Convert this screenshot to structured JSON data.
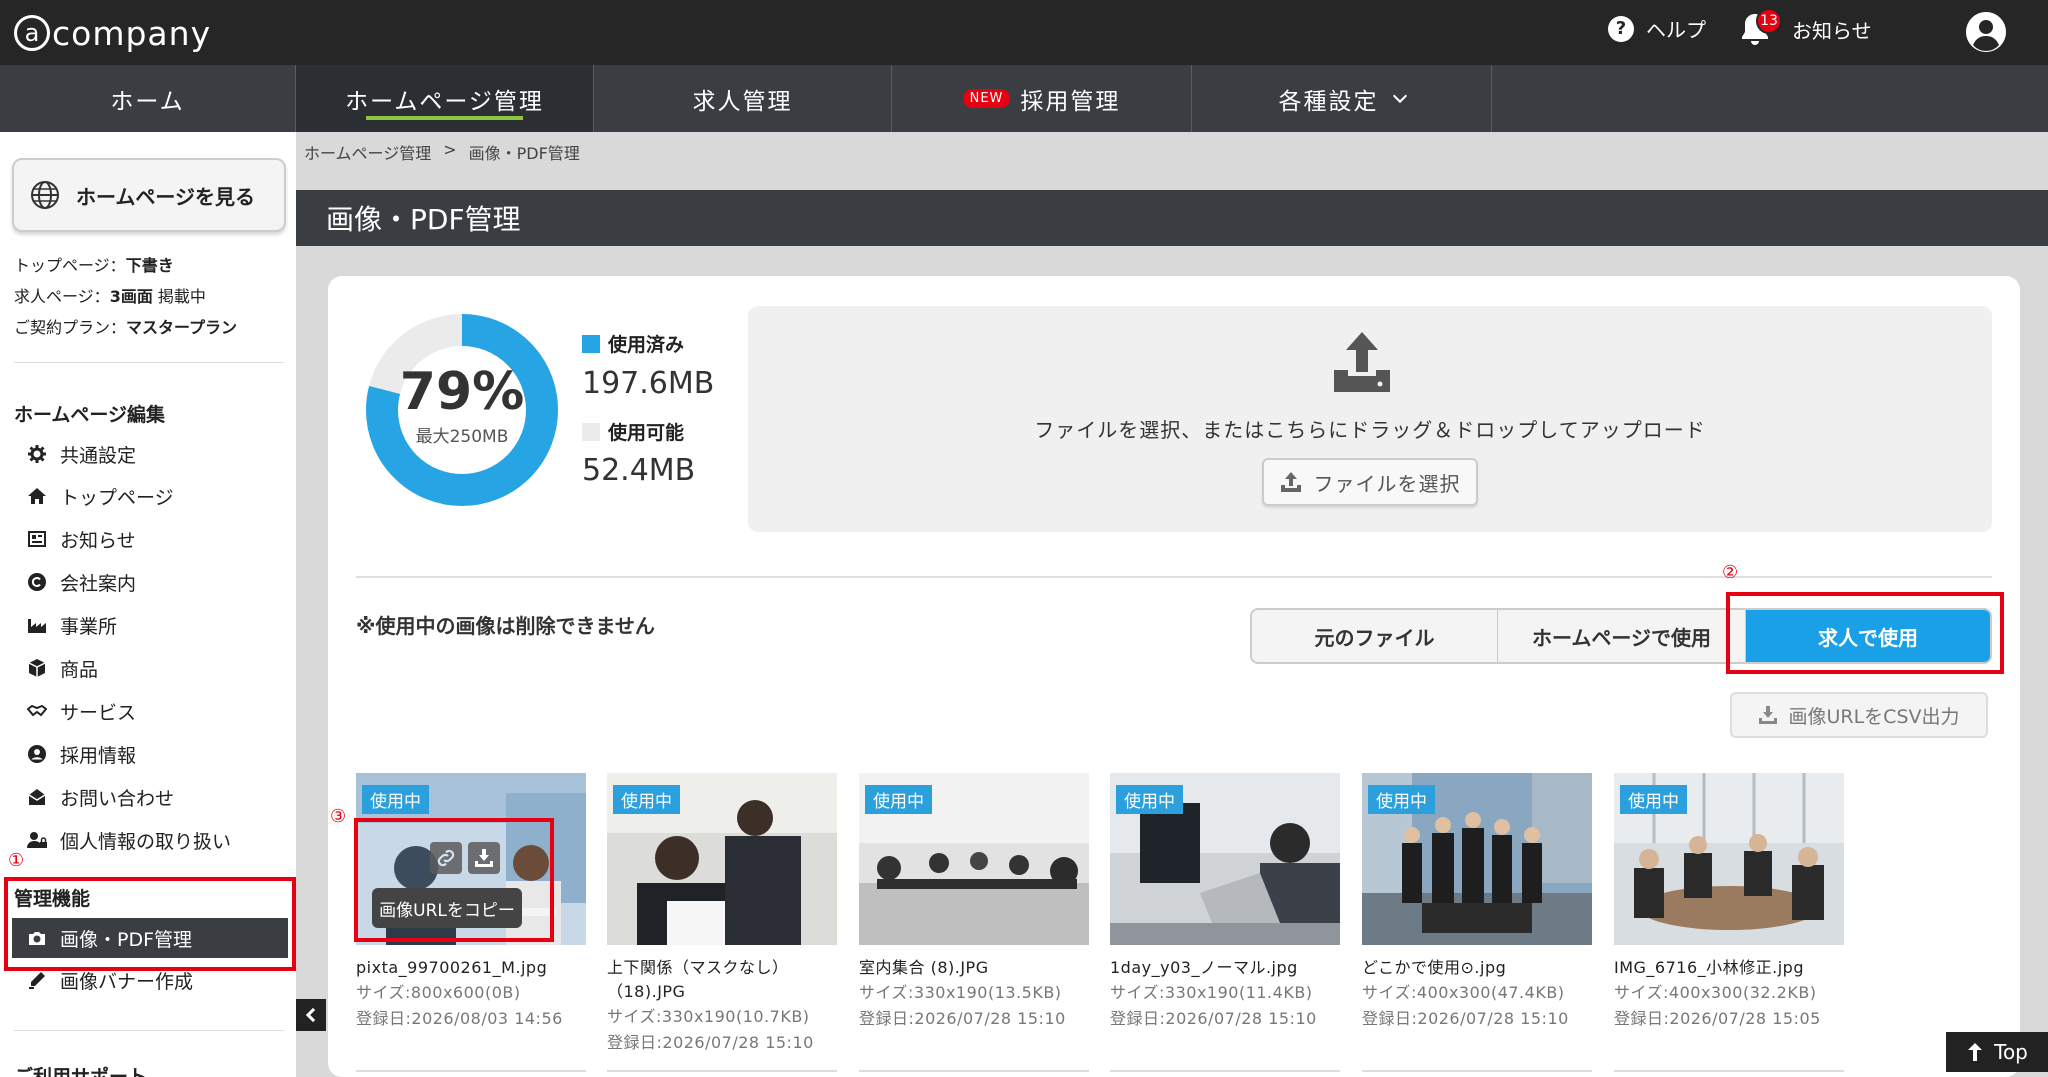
{
  "header": {
    "logo_text": "company",
    "help_label": "ヘルプ",
    "notice_label": "お知らせ",
    "notice_count": "13"
  },
  "nav": {
    "tabs": [
      {
        "label": "ホーム"
      },
      {
        "label": "ホームページ管理"
      },
      {
        "label": "求人管理"
      },
      {
        "label": "採用管理",
        "badge": "NEW"
      },
      {
        "label": "各種設定"
      }
    ]
  },
  "sidebar": {
    "view_site_label": "ホームページを見る",
    "info": [
      {
        "label": "トップページ：",
        "value": "下書き",
        "suffix": ""
      },
      {
        "label": "求人ページ：",
        "value": "3画面",
        "suffix": " 掲載中"
      },
      {
        "label": "ご契約プラン：",
        "value": "マスタープラン",
        "suffix": ""
      }
    ],
    "edit_heading": "ホームページ編集",
    "edit_items": [
      {
        "label": "共通設定",
        "icon": "gear-icon"
      },
      {
        "label": "トップページ",
        "icon": "home-icon"
      },
      {
        "label": "お知らせ",
        "icon": "newspaper-icon"
      },
      {
        "label": "会社案内",
        "icon": "copyright-icon"
      },
      {
        "label": "事業所",
        "icon": "industry-icon"
      },
      {
        "label": "商品",
        "icon": "cube-icon"
      },
      {
        "label": "サービス",
        "icon": "handshake-icon"
      },
      {
        "label": "採用情報",
        "icon": "user-circle-icon"
      },
      {
        "label": "お問い合わせ",
        "icon": "envelope-icon"
      },
      {
        "label": "個人情報の取り扱い",
        "icon": "user-lock-icon"
      }
    ],
    "admin_heading": "管理機能",
    "admin_items": [
      {
        "label": "画像・PDF管理",
        "icon": "camera-icon"
      },
      {
        "label": "画像バナー作成",
        "icon": "pen-icon"
      }
    ],
    "support_heading": "ご利用サポート"
  },
  "annotations": {
    "one": "①",
    "two": "②",
    "three": "③"
  },
  "breadcrumb": {
    "parent": "ホームページ管理",
    "separator": ">",
    "current": "画像・PDF管理"
  },
  "page_title": "画像・PDF管理",
  "storage": {
    "percent_label": "79%",
    "percent_value": 79,
    "max_label": "最大250MB",
    "used_label": "使用済み",
    "used_value": "197.6MB",
    "available_label": "使用可能",
    "available_value": "52.4MB",
    "used_color": "#27a4e4",
    "available_color": "#ebebeb"
  },
  "upload": {
    "drop_text": "ファイルを選択、またはこちらにドラッグ＆ドロップしてアップロード",
    "choose_label": "ファイルを選択"
  },
  "warning_text": "※使用中の画像は削除できません",
  "filter": {
    "original": "元のファイル",
    "homepage": "ホームページで使用",
    "jobs": "求人で使用",
    "selected": "求人で使用"
  },
  "csv_label": "画像URLをCSV出力",
  "tooltip_copy": "画像URLをコピー",
  "images": [
    {
      "status": "使用中",
      "name": "pixta_99700261_M.jpg",
      "size": "サイズ:800x600(0B)",
      "date": "登録日:2026/08/03 14:56"
    },
    {
      "status": "使用中",
      "name": "上下関係（マスクなし）（18).JPG",
      "size": "サイズ:330x190(10.7KB)",
      "date": "登録日:2026/07/28 15:10"
    },
    {
      "status": "使用中",
      "name": "室内集合 (8).JPG",
      "size": "サイズ:330x190(13.5KB)",
      "date": "登録日:2026/07/28 15:10"
    },
    {
      "status": "使用中",
      "name": "1day_y03_ノーマル.jpg",
      "size": "サイズ:330x190(11.4KB)",
      "date": "登録日:2026/07/28 15:10"
    },
    {
      "status": "使用中",
      "name": "どこかで使用⊙.jpg",
      "size": "サイズ:400x300(47.4KB)",
      "date": "登録日:2026/07/28 15:10"
    },
    {
      "status": "使用中",
      "name": "IMG_6716_小林修正.jpg",
      "size": "サイズ:400x300(32.2KB)",
      "date": "登録日:2026/07/28 15:05"
    }
  ],
  "top_button": "Top"
}
